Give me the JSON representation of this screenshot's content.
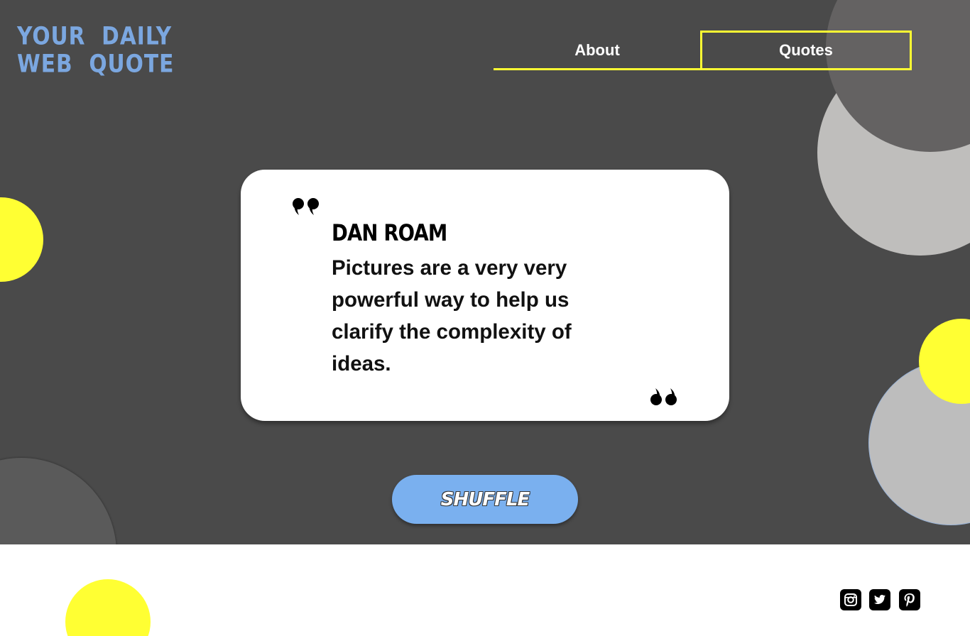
{
  "logo": {
    "line1": "YOUR  DAILY",
    "line2": "WEB  QUOTE"
  },
  "nav": {
    "items": [
      {
        "label": "About"
      },
      {
        "label": "Quotes"
      }
    ],
    "active": "Quotes"
  },
  "quote": {
    "author": "DAN ROAM",
    "text": "Pictures are a very very powerful way to help us clarify the complexity of ideas."
  },
  "shuffle": {
    "label": "SHUFFLE"
  },
  "footer": {
    "social": [
      "instagram-icon",
      "twitter-icon",
      "pinterest-icon"
    ]
  },
  "colors": {
    "background": "#4a4a4a",
    "accent_yellow": "#ffff33",
    "accent_blue": "#7ab0ef",
    "logo_blue": "#7ba7e0",
    "card": "#ffffff"
  }
}
